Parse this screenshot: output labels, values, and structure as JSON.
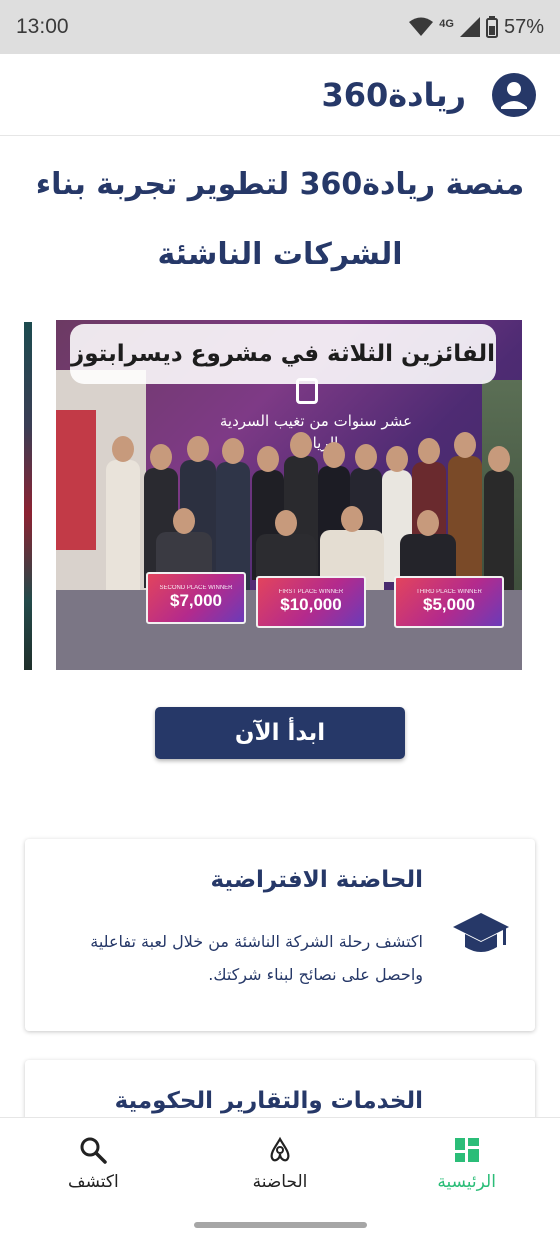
{
  "status_bar": {
    "time": "13:00",
    "network": "4G",
    "battery": "57%",
    "icons": [
      "wifi-icon",
      "signal-icon",
      "battery-icon"
    ]
  },
  "app_bar": {
    "title": "ريادة360",
    "avatar_icon": "account-circle-icon"
  },
  "hero": {
    "title": "منصة ريادة360 لتطوير تجربة بناء الشركات الناشئة"
  },
  "carousel": {
    "caption": "الفائزين الثلاثة في مشروع ديسرابتوز",
    "banner_text": "عشر سنوات من تغيب السردية الريادية",
    "checks": [
      {
        "label": "SECOND PLACE WINNER",
        "amount": "$7,000"
      },
      {
        "label": "FIRST PLACE WINNER",
        "amount": "$10,000"
      },
      {
        "label": "THIRD PLACE WINNER",
        "amount": "$5,000"
      }
    ]
  },
  "start_button": {
    "label": "ابدأ الآن"
  },
  "cards": [
    {
      "title": "الحاضنة الافتراضية",
      "description": "اكتشف رحلة الشركة الناشئة من خلال لعبة تفاعلية واحصل على نصائح لبناء شركتك.",
      "icon": "graduation-cap-icon"
    },
    {
      "title": "الخدمات والتقارير الحكومية"
    }
  ],
  "bottom_nav": {
    "items": [
      {
        "label": "الرئيسية",
        "icon": "grid-icon",
        "active": true
      },
      {
        "label": "الحاضنة",
        "icon": "incubator-icon",
        "active": false
      },
      {
        "label": "اكتشف",
        "icon": "search-icon",
        "active": false
      }
    ]
  },
  "colors": {
    "brand": "#263868",
    "active_nav": "#2bbd78",
    "status_bar": "#dedede"
  }
}
